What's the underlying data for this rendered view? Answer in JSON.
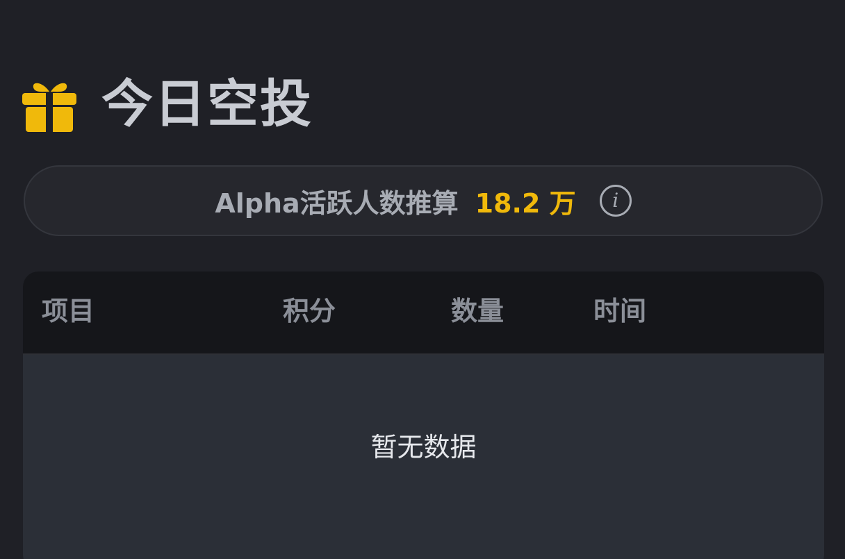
{
  "header": {
    "icon": "gift-icon",
    "title": "今日空投"
  },
  "stats": {
    "label": "Alpha活跃人数推算",
    "value": "18.2 万",
    "info_icon": "info-icon",
    "info_glyph": "i"
  },
  "table": {
    "columns": [
      "项目",
      "积分",
      "数量",
      "时间"
    ],
    "empty_text": "暂无数据"
  },
  "colors": {
    "accent": "#f0b90b",
    "background": "#1f2026",
    "table_header_bg": "#15161a",
    "table_body_bg": "#2b2f37"
  }
}
